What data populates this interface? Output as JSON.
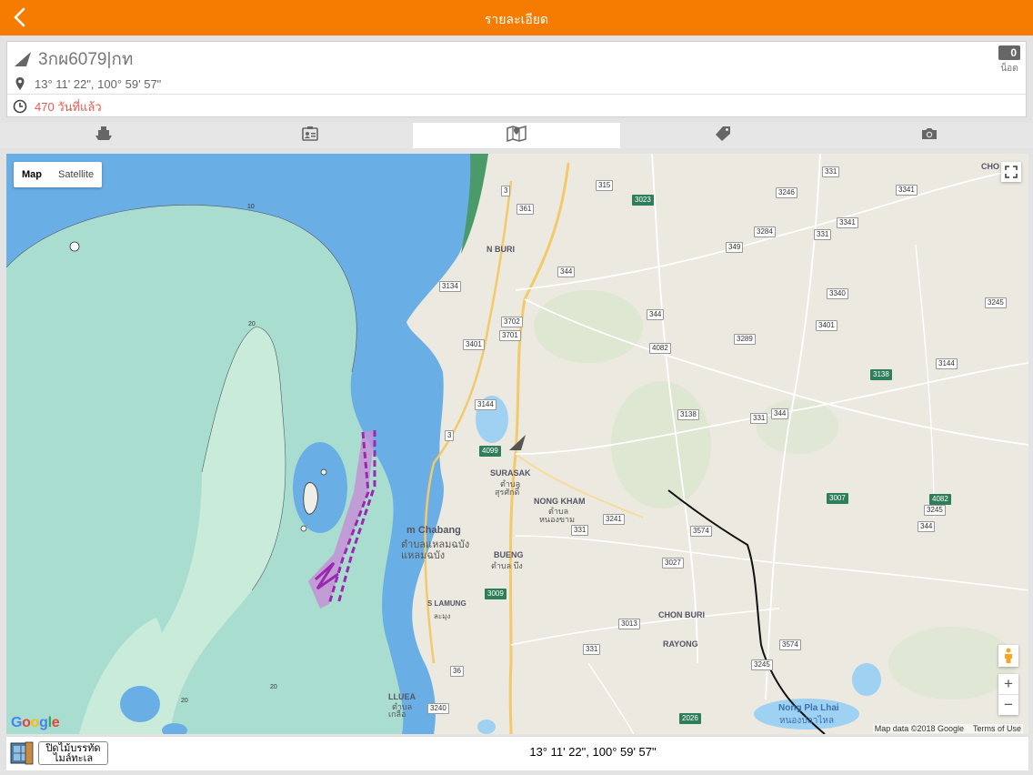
{
  "header": {
    "title": "รายละเอียด"
  },
  "vehicle": {
    "plate": "3กผ6079|กท",
    "coordinates": "13° 11' 22\", 100° 59' 57\"",
    "last_update": "470 วันที่แล้ว",
    "speed_value": "0",
    "speed_unit": "น็อต"
  },
  "tabs": [
    {
      "icon": "ship-icon"
    },
    {
      "icon": "id-card-icon"
    },
    {
      "icon": "map-icon",
      "active": true
    },
    {
      "icon": "tag-icon"
    },
    {
      "icon": "camera-icon"
    }
  ],
  "map": {
    "type_map": "Map",
    "type_satellite": "Satellite",
    "attribution": "Map data ©2018 Google",
    "terms": "Terms of Use",
    "google": "Google",
    "zoom_in": "+",
    "zoom_out": "−",
    "places": {
      "chon_buri_top": "CHO",
      "n_buri": "N BURI",
      "surasak_en": "SURASAK",
      "surasak_th1": "ตำบล",
      "surasak_th2": "สุรศักดิ์",
      "nong_kham_en": "NONG KHAM",
      "nong_kham_th1": "ตำบล",
      "nong_kham_th2": "หนองขาม",
      "chabang_en": "m Chabang",
      "chabang_th1": "ตำบลแหลมฉบัง",
      "chabang_th2": "แหลมฉบัง",
      "bueng_en": "BUENG",
      "bueng_th": "ตำบล บึง",
      "lamung_en": "S LAMUNG",
      "lamung_th": "ละมุง",
      "chon_buri_mid": "CHON BURI",
      "rayong": "RAYONG",
      "pla_lhai_en": "Nong Pla Lhai",
      "pla_lhai_th": "หนองปลาไหล",
      "lluea_en": "LLUEA",
      "lluea_th1": "ตำบล",
      "lluea_th2": "เกลือ"
    },
    "routes": [
      "331",
      "3246",
      "3341",
      "315",
      "3023",
      "3",
      "361",
      "3284",
      "3341",
      "331",
      "349",
      "3134",
      "344",
      "3340",
      "3245",
      "3702",
      "3701",
      "344",
      "3289",
      "3401",
      "3144",
      "3138",
      "3401",
      "4082",
      "3144",
      "3138",
      "331",
      "344",
      "3",
      "4099",
      "3007",
      "4082",
      "3241",
      "3574",
      "3245",
      "331",
      "344",
      "3027",
      "3009",
      "3013",
      "3574",
      "331",
      "36",
      "3245",
      "3240",
      "2026"
    ],
    "depths": [
      "10",
      "20",
      "20",
      "20"
    ]
  },
  "footer": {
    "toggle_label_line1": "ปิดไม้บรรทัด",
    "toggle_label_line2": "ไมล์ทะเล",
    "coordinates": "13° 11' 22\", 100° 59' 57\""
  }
}
